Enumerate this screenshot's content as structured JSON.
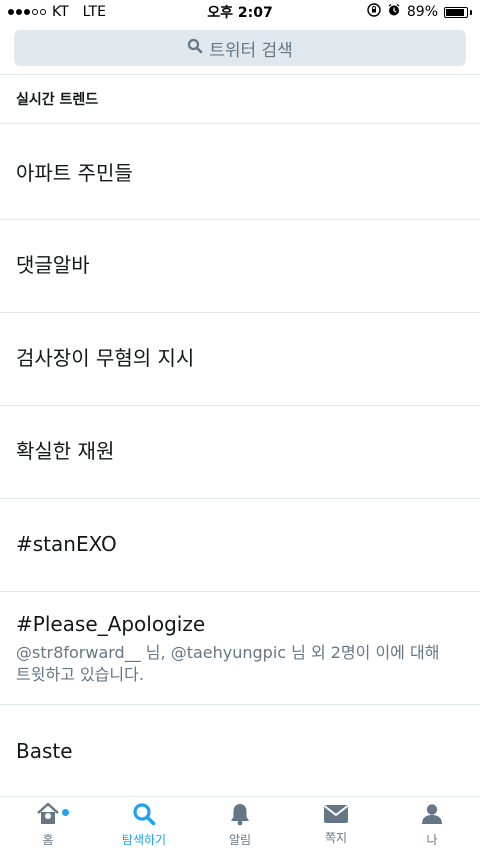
{
  "status": {
    "carrier": "KT",
    "network": "LTE",
    "time": "오후 2:07",
    "battery": "89%",
    "battery_level": 0.89
  },
  "search": {
    "placeholder": "트위터 검색",
    "icon": "search-icon"
  },
  "section": {
    "title": "실시간 트렌드"
  },
  "trends": [
    {
      "name": "아파트 주민들",
      "desc": ""
    },
    {
      "name": "댓글알바",
      "desc": ""
    },
    {
      "name": "검사장이 무혐의 지시",
      "desc": ""
    },
    {
      "name": "확실한 재원",
      "desc": ""
    },
    {
      "name": "#stanEXO",
      "desc": ""
    },
    {
      "name": "#Please_Apologize",
      "desc_line1": "@str8forward__ 님, @taehyungpic 님 외 2명이 이에 대해",
      "desc_line2": "트윗하고 있습니다."
    },
    {
      "name": "Baste",
      "desc": ""
    }
  ],
  "nav": {
    "items": [
      {
        "label": "홈",
        "icon": "home-icon"
      },
      {
        "label": "탐색하기",
        "icon": "search-icon",
        "active": true
      },
      {
        "label": "알림",
        "icon": "bell-icon"
      },
      {
        "label": "쪽지",
        "icon": "envelope-icon"
      },
      {
        "label": "나",
        "icon": "person-icon"
      }
    ],
    "accent": "#1da1f2",
    "inactive": "#657786"
  }
}
